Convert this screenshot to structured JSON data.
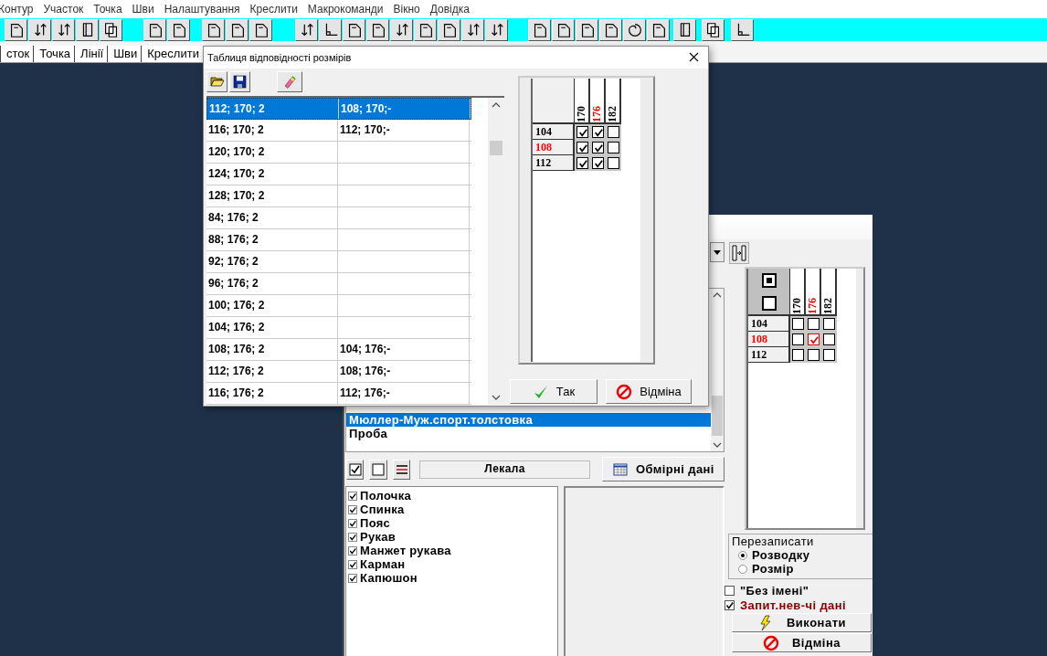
{
  "menu": [
    "Контур",
    "Участок",
    "Точка",
    "Шви",
    "Налаштування",
    "Креслити",
    "Макрокоманди",
    "Вікно",
    "Довідка"
  ],
  "tabs": [
    "сток",
    "Точка",
    "Лінії",
    "Шви",
    "Креслити"
  ],
  "dialog": {
    "title": "Таблиця відповідності розмірів",
    "rows": [
      {
        "size": "112; 170; 2",
        "match": "108; 170;-",
        "selected": true
      },
      {
        "size": "116; 170; 2",
        "match": "112; 170;-",
        "selected": false
      },
      {
        "size": "120; 170; 2",
        "selected": false
      },
      {
        "size": "124; 170; 2",
        "selected": false
      },
      {
        "size": "128; 170; 2",
        "selected": false
      },
      {
        "size": "84; 176; 2",
        "selected": false
      },
      {
        "size": "88; 176; 2",
        "selected": false
      },
      {
        "size": "92; 176; 2",
        "selected": false
      },
      {
        "size": "96; 176; 2",
        "selected": false
      },
      {
        "size": "100; 176; 2",
        "selected": false
      },
      {
        "size": "104; 176; 2",
        "selected": false
      },
      {
        "size": "108; 176; 2",
        "match": "104; 176;-",
        "selected": false
      },
      {
        "size": "112; 176; 2",
        "match": "108; 176;-",
        "selected": false
      },
      {
        "size": "116; 176; 2",
        "match": "112; 176;-",
        "selected": false
      }
    ],
    "matrix": {
      "kind": "source",
      "columns": [
        {
          "label": "170",
          "highlighted": false
        },
        {
          "label": "176",
          "highlighted": true
        },
        {
          "label": "182",
          "highlighted": false
        }
      ],
      "rows": [
        {
          "label": "104",
          "highlighted": false,
          "cells": [
            {
              "checked": true
            },
            {
              "checked": true
            },
            {
              "checked": false
            }
          ]
        },
        {
          "label": "108",
          "highlighted": true,
          "cells": [
            {
              "checked": true
            },
            {
              "checked": true
            },
            {
              "checked": false
            }
          ]
        },
        {
          "label": "112",
          "highlighted": false,
          "cells": [
            {
              "checked": true
            },
            {
              "checked": true
            },
            {
              "checked": false
            }
          ]
        }
      ]
    },
    "buttons": [
      {
        "kind": "ok",
        "label": "Так"
      },
      {
        "kind": "cancel",
        "label": "Відміна"
      }
    ]
  },
  "back_window": {
    "list": [
      {
        "label": "Мюллер-Муж.спорт.толстовка",
        "selected": true
      },
      {
        "label": "Проба",
        "selected": false
      }
    ],
    "patterns_label": "Лекала",
    "measure_button": "Обмірні дані",
    "pieces": [
      {
        "label": "Полочка",
        "checked": true
      },
      {
        "label": "Спинка",
        "checked": true
      },
      {
        "label": "Пояс",
        "checked": true
      },
      {
        "label": "Рукав",
        "checked": true
      },
      {
        "label": "Манжет рукава",
        "checked": true
      },
      {
        "label": "Карман",
        "checked": true
      },
      {
        "label": "Капюшон",
        "checked": true
      }
    ],
    "matrix": {
      "kind": "result",
      "columns": [
        {
          "label": "170",
          "highlighted": false
        },
        {
          "label": "176",
          "highlighted": true
        },
        {
          "label": "182",
          "highlighted": false
        }
      ],
      "rows": [
        {
          "label": "104",
          "highlighted": false,
          "cells": [
            {
              "checked": false
            },
            {
              "checked": false
            },
            {
              "checked": false
            }
          ]
        },
        {
          "label": "108",
          "highlighted": true,
          "cells": [
            {
              "checked": false
            },
            {
              "checked": true
            },
            {
              "checked": false
            }
          ]
        },
        {
          "label": "112",
          "highlighted": false,
          "cells": [
            {
              "checked": false
            },
            {
              "checked": false
            },
            {
              "checked": false
            }
          ]
        }
      ]
    },
    "overwrite": {
      "title": "Перезаписати",
      "options": [
        {
          "label": "Розводку",
          "selected": true
        },
        {
          "label": "Розмір",
          "selected": false
        }
      ]
    },
    "options": [
      {
        "label": "\"Без імені\"",
        "checked": false,
        "color": "#000000"
      },
      {
        "label": "Запит.нев-чі дані",
        "checked": true,
        "color": "#8b0000"
      }
    ],
    "buttons": [
      {
        "kind": "run",
        "label": "Виконати"
      },
      {
        "kind": "cancel",
        "label": "Відміна"
      }
    ]
  }
}
